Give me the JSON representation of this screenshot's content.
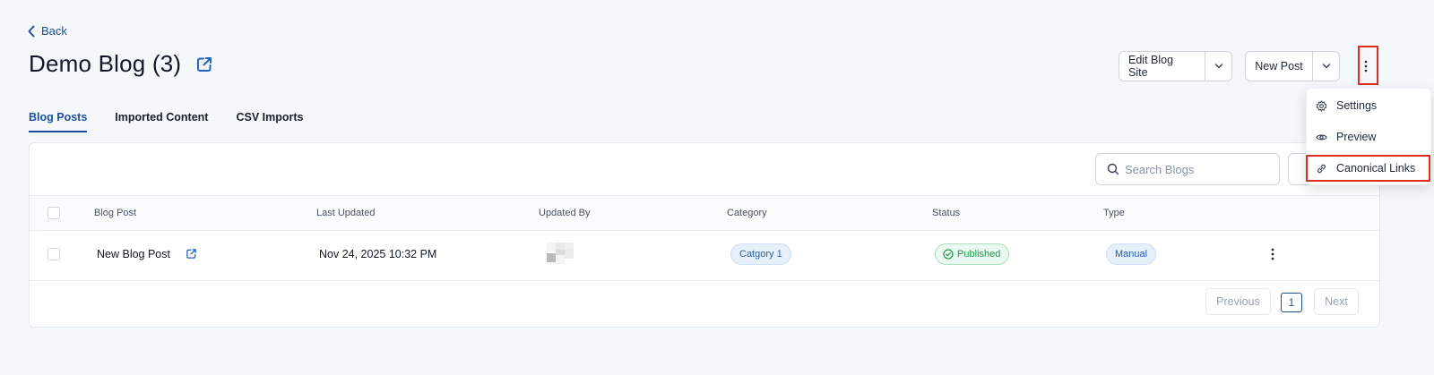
{
  "header": {
    "back_label": "Back",
    "page_title": "Demo Blog (3)"
  },
  "actions": {
    "edit_site_label": "Edit Blog Site",
    "new_post_label": "New Post"
  },
  "menu": {
    "items": [
      {
        "label": "Settings",
        "icon": "gear-icon"
      },
      {
        "label": "Preview",
        "icon": "eye-icon"
      },
      {
        "label": "Canonical Links",
        "icon": "link-icon"
      }
    ]
  },
  "tabs": [
    {
      "label": "Blog Posts",
      "active": true
    },
    {
      "label": "Imported Content",
      "active": false
    },
    {
      "label": "CSV Imports",
      "active": false
    }
  ],
  "search": {
    "placeholder": "Search Blogs",
    "value": ""
  },
  "table": {
    "columns": [
      "Blog Post",
      "Last Updated",
      "Updated By",
      "Category",
      "Status",
      "Type"
    ],
    "rows": [
      {
        "blog_post": "New Blog Post",
        "last_updated": "Nov 24, 2025 10:32 PM",
        "updated_by": "",
        "category": "Catgory 1",
        "status": "Published",
        "type": "Manual"
      }
    ]
  },
  "pagination": {
    "previous_label": "Previous",
    "current_page": "1",
    "next_label": "Next"
  },
  "colors": {
    "accent": "#1d4f9c",
    "highlight": "#e02b20",
    "status_published": "#1d9a4e"
  }
}
